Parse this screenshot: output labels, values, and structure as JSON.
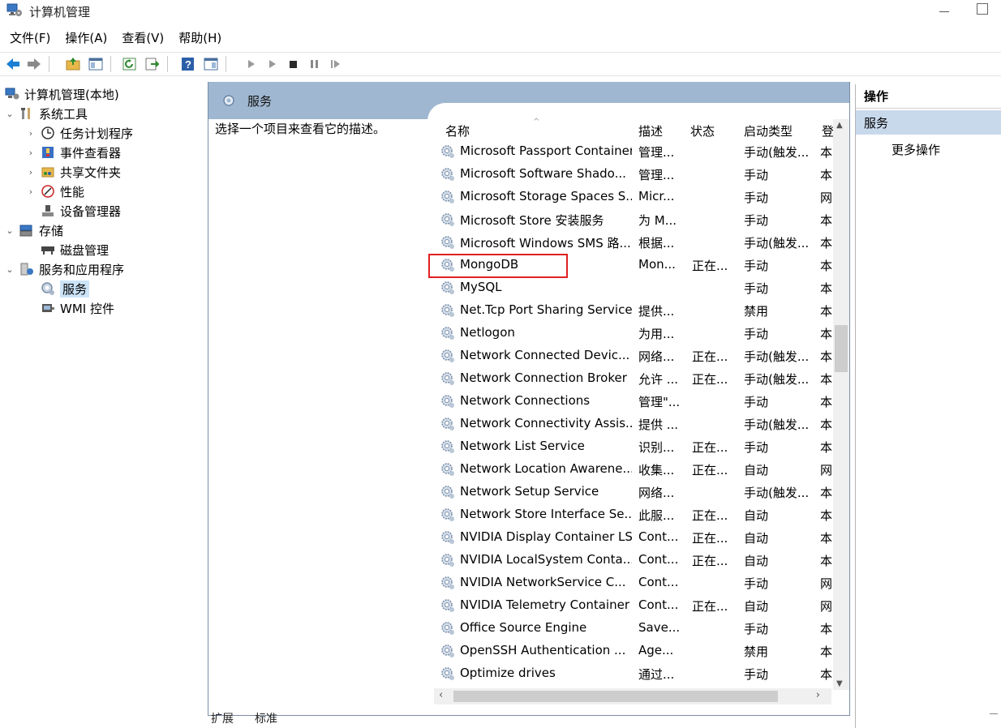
{
  "window": {
    "title": "计算机管理"
  },
  "menu": [
    "文件(F)",
    "操作(A)",
    "查看(V)",
    "帮助(H)"
  ],
  "toolbar": {
    "icons": [
      "back-arrow-icon",
      "forward-arrow-icon",
      "up-folder-icon",
      "show-hide-tree-icon",
      "refresh-icon",
      "export-list-icon",
      "help-icon",
      "show-hide-action-pane-icon",
      "start-service-icon",
      "start-service-alt-icon",
      "stop-service-icon",
      "pause-service-icon",
      "restart-service-icon"
    ]
  },
  "tree": {
    "items": [
      {
        "label": "计算机管理(本地)",
        "icon": "computer-management-icon"
      },
      {
        "label": "系统工具",
        "icon": "tools-icon",
        "chevron": "⌄"
      },
      {
        "label": "任务计划程序",
        "icon": "task-scheduler-icon",
        "chevron": "›"
      },
      {
        "label": "事件查看器",
        "icon": "event-viewer-icon",
        "chevron": "›"
      },
      {
        "label": "共享文件夹",
        "icon": "shared-folders-icon",
        "chevron": "›"
      },
      {
        "label": "性能",
        "icon": "performance-icon",
        "chevron": "›"
      },
      {
        "label": "设备管理器",
        "icon": "device-manager-icon"
      },
      {
        "label": "存储",
        "icon": "storage-icon",
        "chevron": "⌄"
      },
      {
        "label": "磁盘管理",
        "icon": "disk-management-icon"
      },
      {
        "label": "服务和应用程序",
        "icon": "services-apps-icon",
        "chevron": "⌄"
      },
      {
        "label": "服务",
        "icon": "services-icon",
        "selected": true
      },
      {
        "label": "WMI 控件",
        "icon": "wmi-control-icon"
      }
    ]
  },
  "center": {
    "header_title": "服务",
    "description": "选择一个项目来查看它的描述。",
    "columns": {
      "name": "名称",
      "desc": "描述",
      "status": "状态",
      "startup": "启动类型",
      "logon": "登"
    },
    "sort_indicator": "^",
    "rows": [
      {
        "name": "Microsoft Passport Container",
        "desc": "管理...",
        "status": "",
        "startup": "手动(触发...",
        "logon": "本"
      },
      {
        "name": "Microsoft Software Shado...",
        "desc": "管理...",
        "status": "",
        "startup": "手动",
        "logon": "本"
      },
      {
        "name": "Microsoft Storage Spaces S...",
        "desc": "Micr...",
        "status": "",
        "startup": "手动",
        "logon": "网"
      },
      {
        "name": "Microsoft Store 安装服务",
        "desc": "为 M...",
        "status": "",
        "startup": "手动",
        "logon": "本"
      },
      {
        "name": "Microsoft Windows SMS 路...",
        "desc": "根据...",
        "status": "",
        "startup": "手动(触发...",
        "logon": "本"
      },
      {
        "name": "MongoDB",
        "desc": "Mon...",
        "status": "正在...",
        "startup": "手动",
        "logon": "本"
      },
      {
        "name": "MySQL",
        "desc": "",
        "status": "",
        "startup": "手动",
        "logon": "本"
      },
      {
        "name": "Net.Tcp Port Sharing Service",
        "desc": "提供...",
        "status": "",
        "startup": "禁用",
        "logon": "本"
      },
      {
        "name": "Netlogon",
        "desc": "为用...",
        "status": "",
        "startup": "手动",
        "logon": "本"
      },
      {
        "name": "Network Connected Devic...",
        "desc": "网络...",
        "status": "正在...",
        "startup": "手动(触发...",
        "logon": "本"
      },
      {
        "name": "Network Connection Broker",
        "desc": "允许 ...",
        "status": "正在...",
        "startup": "手动(触发...",
        "logon": "本"
      },
      {
        "name": "Network Connections",
        "desc": "管理\"...",
        "status": "",
        "startup": "手动",
        "logon": "本"
      },
      {
        "name": "Network Connectivity Assis...",
        "desc": "提供 ...",
        "status": "",
        "startup": "手动(触发...",
        "logon": "本"
      },
      {
        "name": "Network List Service",
        "desc": "识别...",
        "status": "正在...",
        "startup": "手动",
        "logon": "本"
      },
      {
        "name": "Network Location Awarene...",
        "desc": "收集...",
        "status": "正在...",
        "startup": "自动",
        "logon": "网"
      },
      {
        "name": "Network Setup Service",
        "desc": "网络...",
        "status": "",
        "startup": "手动(触发...",
        "logon": "本"
      },
      {
        "name": "Network Store Interface Se...",
        "desc": "此服...",
        "status": "正在...",
        "startup": "自动",
        "logon": "本"
      },
      {
        "name": "NVIDIA Display Container LS",
        "desc": "Cont...",
        "status": "正在...",
        "startup": "自动",
        "logon": "本"
      },
      {
        "name": "NVIDIA LocalSystem Conta...",
        "desc": "Cont...",
        "status": "正在...",
        "startup": "自动",
        "logon": "本"
      },
      {
        "name": "NVIDIA NetworkService C...",
        "desc": "Cont...",
        "status": "",
        "startup": "手动",
        "logon": "网"
      },
      {
        "name": "NVIDIA Telemetry Container",
        "desc": "Cont...",
        "status": "正在...",
        "startup": "自动",
        "logon": "网"
      },
      {
        "name": "Office  Source Engine",
        "desc": "Save...",
        "status": "",
        "startup": "手动",
        "logon": "本"
      },
      {
        "name": "OpenSSH Authentication ...",
        "desc": "Age...",
        "status": "",
        "startup": "禁用",
        "logon": "本"
      },
      {
        "name": "Optimize drives",
        "desc": "通过...",
        "status": "",
        "startup": "手动",
        "logon": "本"
      }
    ]
  },
  "bottom_tabs": [
    "扩展",
    "标准"
  ],
  "actions": {
    "title": "操作",
    "section": "服务",
    "more": "更多操作"
  },
  "colors": {
    "panel_header": "#9fb7d0",
    "selection": "#cce4f7",
    "highlight_box": "#e02020",
    "actions_section": "#c9d9ec"
  }
}
